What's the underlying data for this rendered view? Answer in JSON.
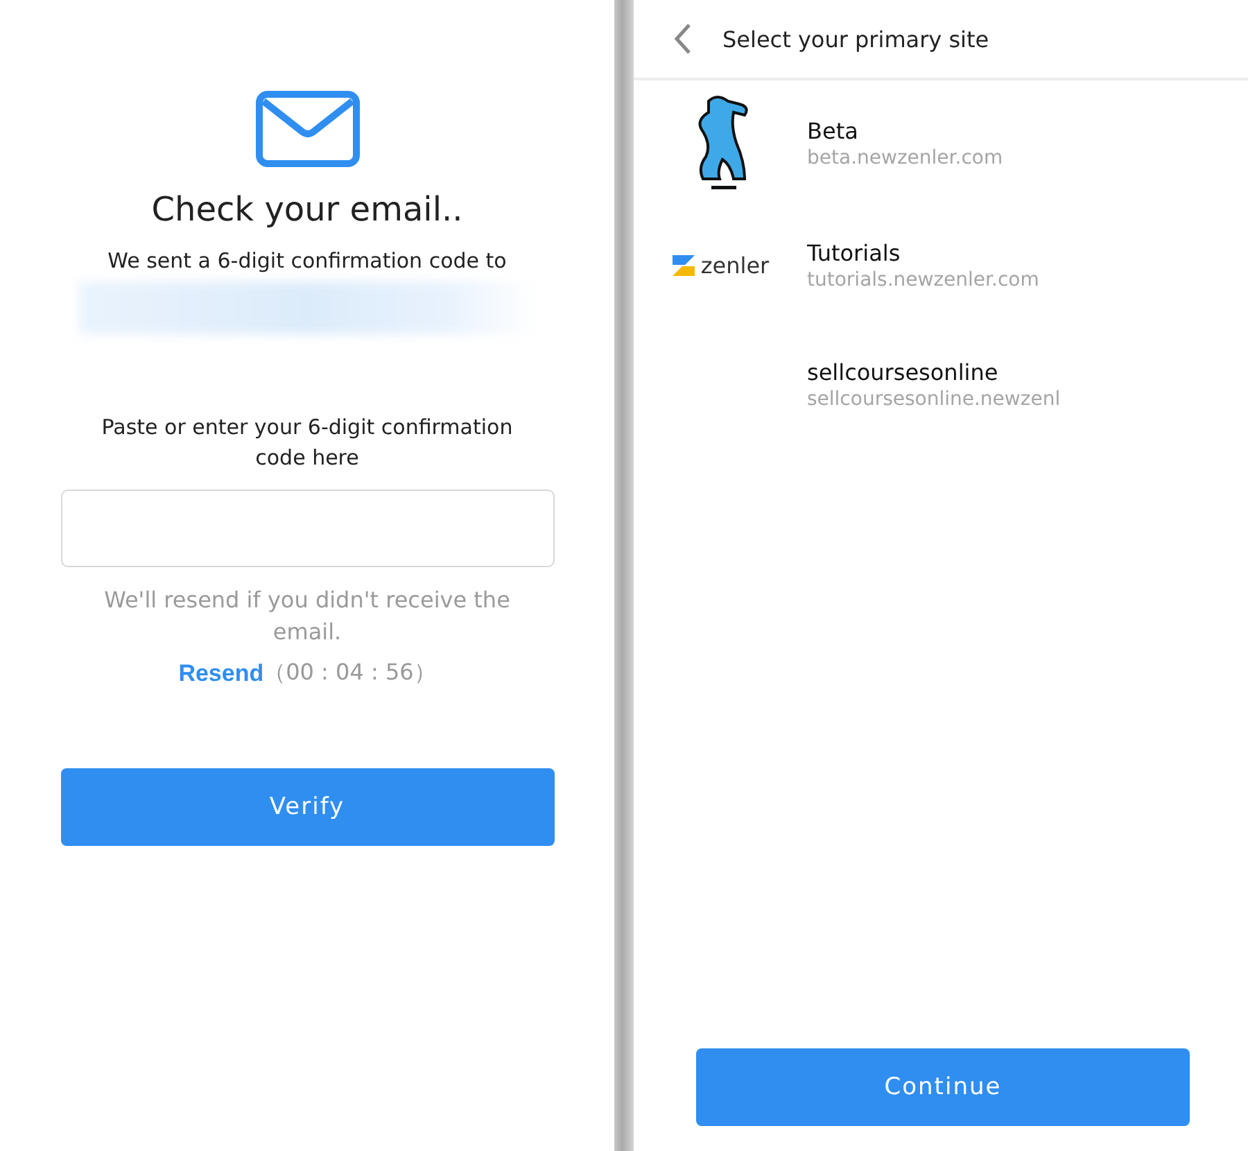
{
  "verify_screen": {
    "title": "Check your email..",
    "sent_text": "We sent a 6-digit confirmation code to",
    "prompt": "Paste or enter your 6-digit confirmation code here",
    "hint": "We'll resend if you didn't receive the email.",
    "resend_link": "Resend",
    "countdown": "（00 : 04 : 56）",
    "button": "Verify"
  },
  "site_screen": {
    "title": "Select your primary site",
    "sites": [
      {
        "kind": "dog",
        "name": "Beta",
        "url": "beta.newzenler.com"
      },
      {
        "kind": "zenler",
        "logo_text": "zenler",
        "name": "Tutorials",
        "url": "tutorials.newzenler.com"
      },
      {
        "kind": "plain",
        "name": "sellcoursesonline",
        "url": "sellcoursesonline.newzenl"
      }
    ],
    "button": "Continue"
  }
}
